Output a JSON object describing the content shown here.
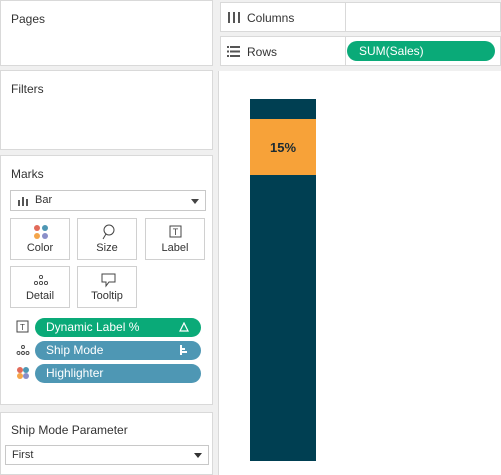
{
  "pages": {
    "title": "Pages"
  },
  "filters": {
    "title": "Filters"
  },
  "marks": {
    "title": "Marks",
    "mark_type": "Bar",
    "buttons": [
      {
        "label": "Color",
        "icon": "color-dots-icon"
      },
      {
        "label": "Size",
        "icon": "size-lasso-icon"
      },
      {
        "label": "Label",
        "icon": "text-label-icon"
      },
      {
        "label": "Detail",
        "icon": "detail-dots-icon"
      },
      {
        "label": "Tooltip",
        "icon": "speech-bubble-icon"
      }
    ],
    "pills": [
      {
        "label": "Dynamic Label %",
        "icon": "text-label-icon",
        "color": "#0aaa78",
        "trailing_icon": "delta-icon"
      },
      {
        "label": "Ship Mode",
        "icon": "detail-dots-icon",
        "color": "#4e97b4",
        "trailing_icon": "sort-icon"
      },
      {
        "label": "Highlighter",
        "icon": "color-dots-icon",
        "color": "#4e97b4"
      }
    ]
  },
  "parameter": {
    "title": "Ship Mode Parameter",
    "value": "First"
  },
  "shelves": {
    "columns": {
      "label": "Columns",
      "icon": "columns-icon"
    },
    "rows": {
      "label": "Rows",
      "icon": "rows-icon",
      "pill": "SUM(Sales)",
      "pill_color": "#0aaa78"
    }
  },
  "colors": {
    "bar": "#003f52",
    "highlight": "#f7a239",
    "label_text": "#1a2a33"
  },
  "chart_data": {
    "type": "bar",
    "categories": [
      ""
    ],
    "values": [
      1
    ],
    "highlight_share": 0.15,
    "data_labels": [
      "15%"
    ],
    "title": "",
    "xlabel": "",
    "ylabel": ""
  }
}
